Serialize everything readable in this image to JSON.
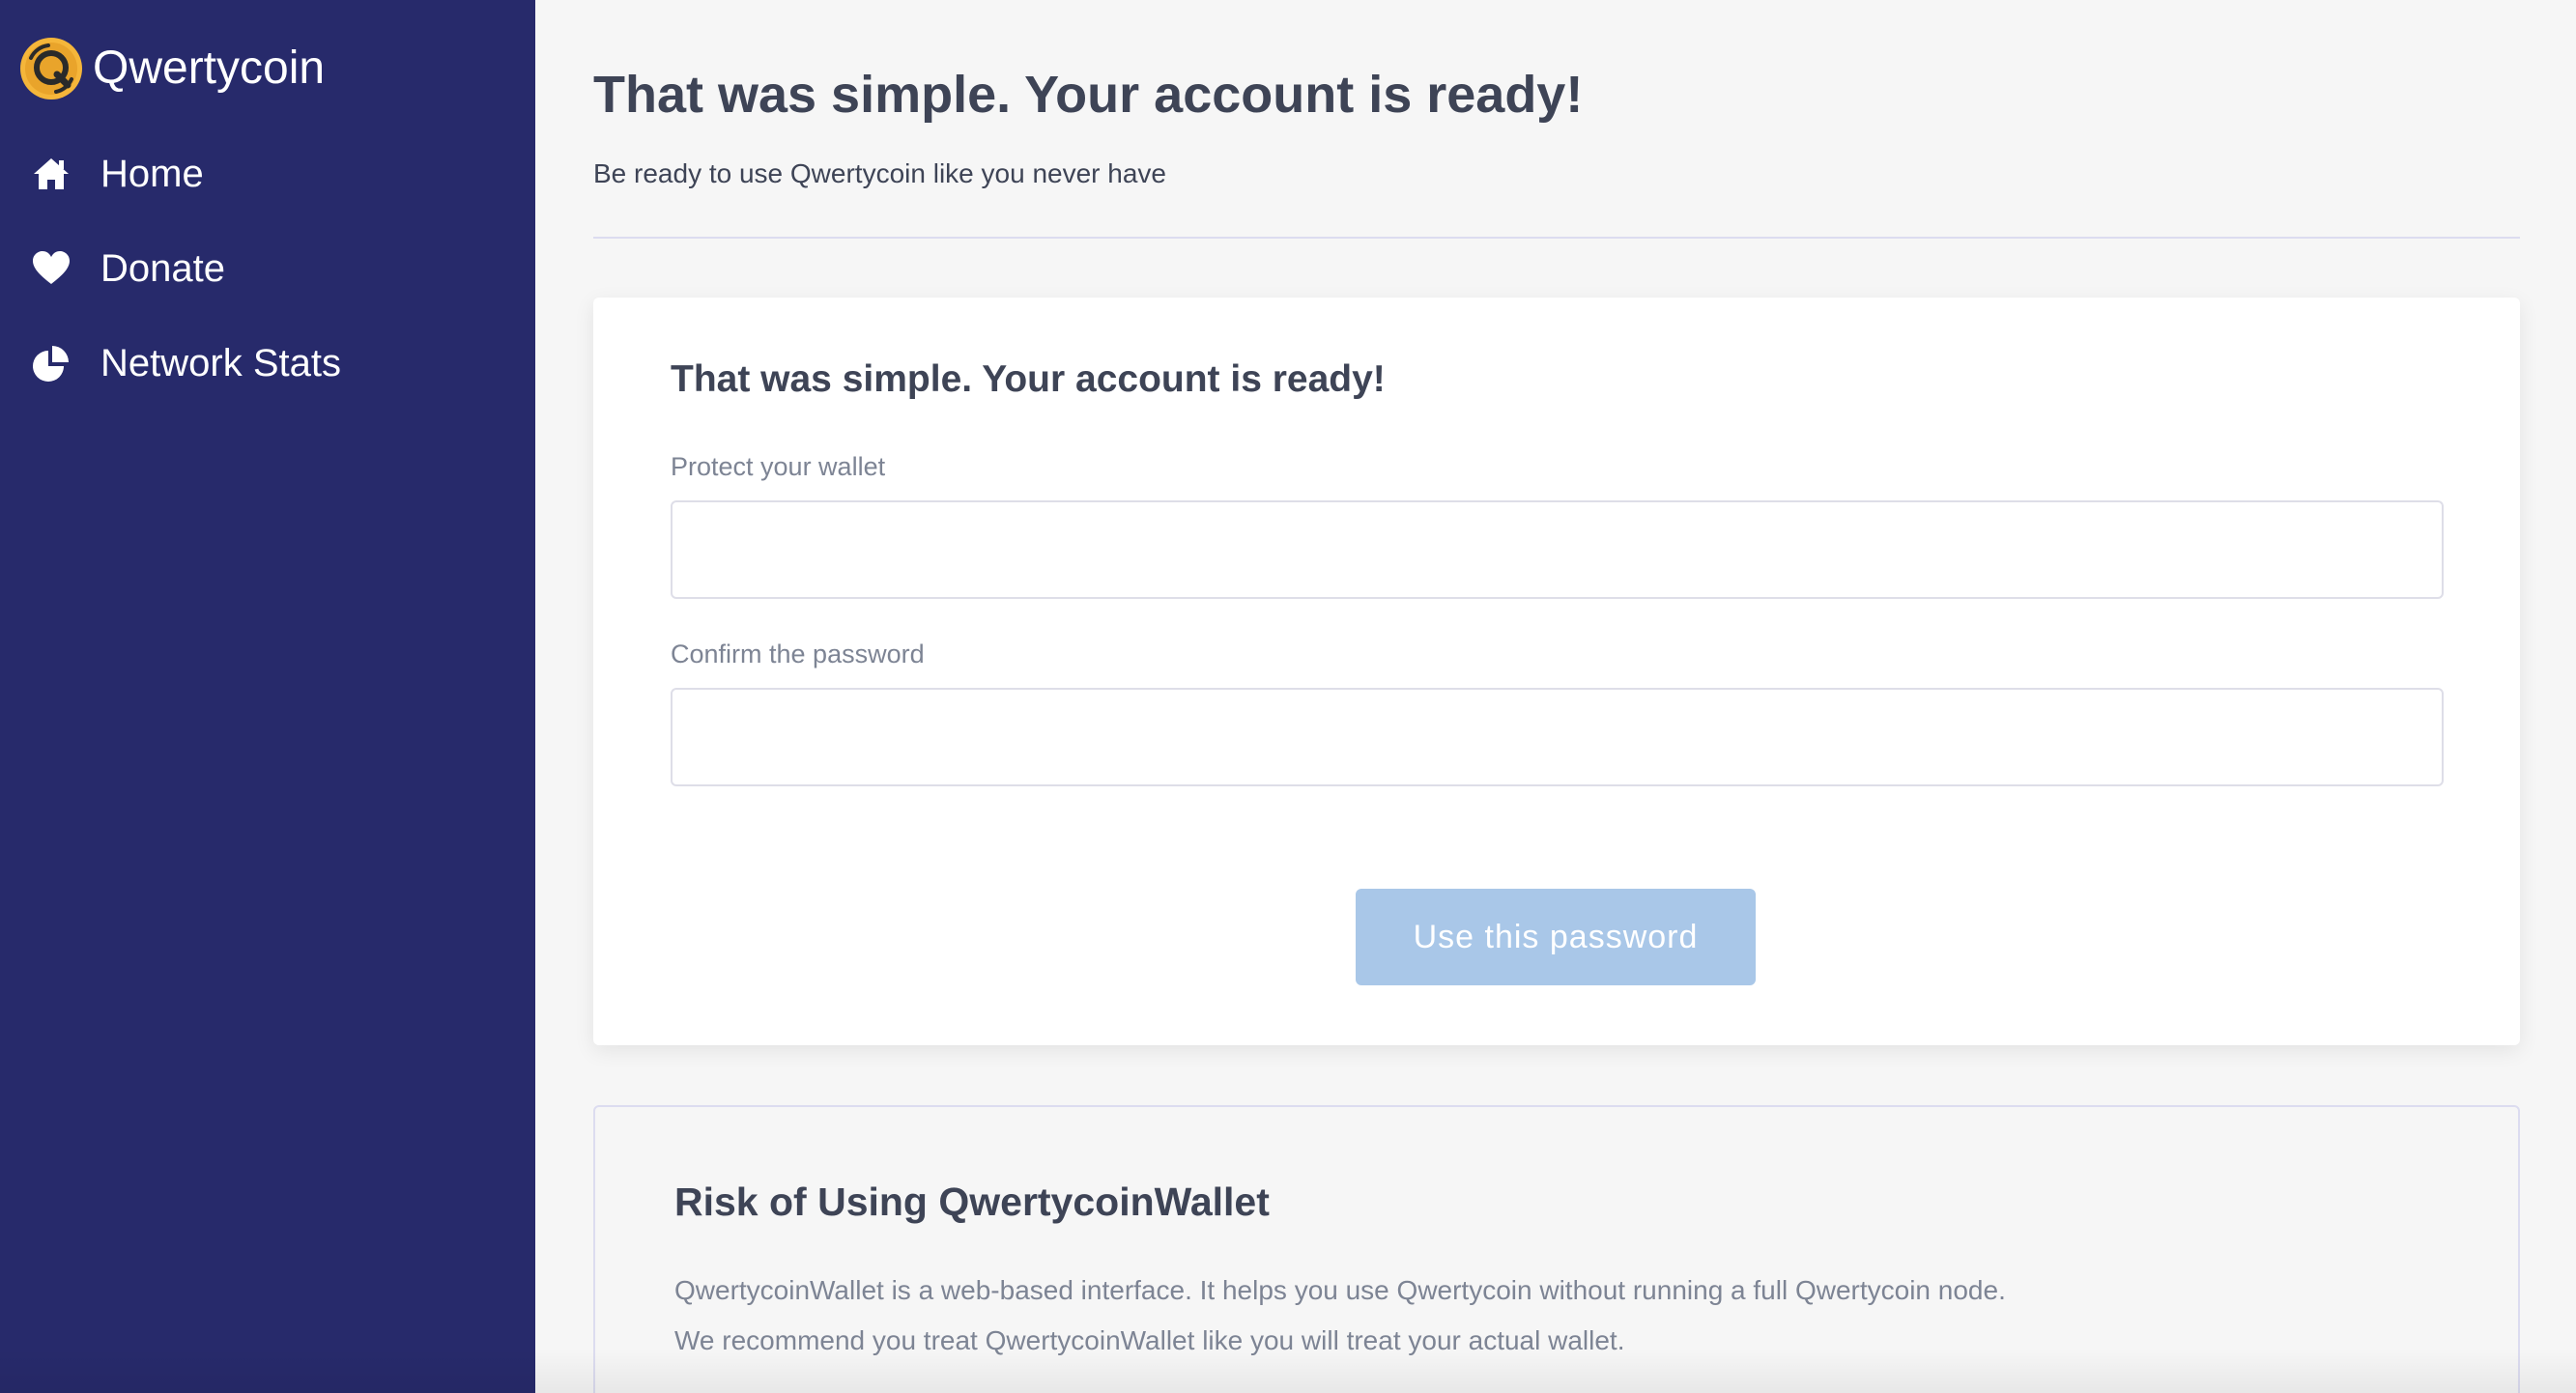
{
  "brand": {
    "name": "Qwertycoin",
    "logo_icon": "qwertycoin-logo-icon",
    "accent": "#f5b63a"
  },
  "sidebar": {
    "background": "#272a6b",
    "items": [
      {
        "label": "Home",
        "icon": "home-icon"
      },
      {
        "label": "Donate",
        "icon": "heart-icon"
      },
      {
        "label": "Network Stats",
        "icon": "pie-chart-icon"
      }
    ]
  },
  "header": {
    "title": "That was simple. Your account is ready!",
    "subtitle": "Be ready to use Qwertycoin like you never have"
  },
  "password_card": {
    "title": "That was simple. Your account is ready!",
    "protect_label": "Protect your wallet",
    "protect_value": "",
    "confirm_label": "Confirm the password",
    "confirm_value": "",
    "submit_label": "Use this password",
    "submit_color": "#a9c7e8"
  },
  "risk_card": {
    "title": "Risk of Using QwertycoinWallet",
    "line1": "QwertycoinWallet is a web-based interface. It helps you use Qwertycoin without running a full Qwertycoin node.",
    "line2": "We recommend you treat QwertycoinWallet like you will treat your actual wallet."
  }
}
